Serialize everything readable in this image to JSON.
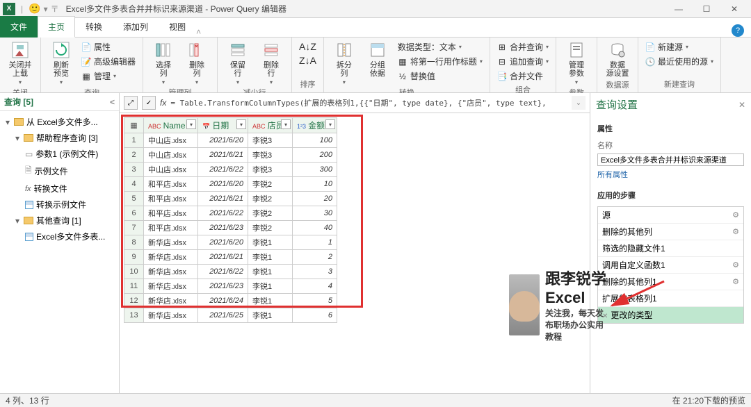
{
  "titlebar": {
    "title": "Excel多文件多表合并并标识来源渠道 - Power Query 编辑器"
  },
  "ribbon_tabs": {
    "file": "文件",
    "home": "主页",
    "transform": "转换",
    "addcol": "添加列",
    "view": "视图"
  },
  "ribbon": {
    "close_apply": "关闭并\n上载",
    "refresh": "刷新\n预览",
    "props": "属性",
    "adv_editor": "高级编辑器",
    "manage": "管理",
    "choose_col": "选择\n列",
    "remove_col": "删除\n列",
    "keep_row": "保留\n行",
    "remove_row": "删除\n行",
    "sort_asc": "↑",
    "sort_desc": "↓",
    "split": "拆分\n列",
    "groupby": "分组\n依据",
    "dtype": "数据类型：文本",
    "first_row": "将第一行用作标题",
    "replace": "替换值",
    "merge": "合并查询",
    "append": "追加查询",
    "combine_files": "合并文件",
    "params": "管理\n参数",
    "datasrc": "数据\n源设置",
    "newsrc": "新建源",
    "recent": "最近使用的源",
    "grp_close": "关闭",
    "grp_query": "查询",
    "grp_cols": "管理列",
    "grp_rows": "减少行",
    "grp_sort": "排序",
    "grp_trans": "转换",
    "grp_combine": "组合",
    "grp_params": "参数",
    "grp_ds": "数据源",
    "grp_new": "新建查询"
  },
  "queries": {
    "header": "查询 [5]",
    "root": "从 Excel多文件多...",
    "helper_folder": "帮助程序查询 [3]",
    "param1": "参数1 (示例文件)",
    "sample": "示例文件",
    "transform_file": "转换文件",
    "transform_sample": "转换示例文件",
    "other_folder": "其他查询 [1]",
    "main_query": "Excel多文件多表..."
  },
  "formula": "= Table.TransformColumnTypes(扩展的表格列1,{{\"日期\", type date}, {\"店员\", type text},",
  "columns": {
    "name": "Name",
    "date": "日期",
    "emp": "店员",
    "amt": "金额",
    "abc": "ABC",
    "cal": "📅",
    "num": "1²3"
  },
  "rows": [
    {
      "n": "中山店.xlsx",
      "d": "2021/6/20",
      "e": "李锐3",
      "a": "100"
    },
    {
      "n": "中山店.xlsx",
      "d": "2021/6/21",
      "e": "李锐3",
      "a": "200"
    },
    {
      "n": "中山店.xlsx",
      "d": "2021/6/22",
      "e": "李锐3",
      "a": "300"
    },
    {
      "n": "和平店.xlsx",
      "d": "2021/6/20",
      "e": "李锐2",
      "a": "10"
    },
    {
      "n": "和平店.xlsx",
      "d": "2021/6/21",
      "e": "李锐2",
      "a": "20"
    },
    {
      "n": "和平店.xlsx",
      "d": "2021/6/22",
      "e": "李锐2",
      "a": "30"
    },
    {
      "n": "和平店.xlsx",
      "d": "2021/6/23",
      "e": "李锐2",
      "a": "40"
    },
    {
      "n": "新华店.xlsx",
      "d": "2021/6/20",
      "e": "李锐1",
      "a": "1"
    },
    {
      "n": "新华店.xlsx",
      "d": "2021/6/21",
      "e": "李锐1",
      "a": "2"
    },
    {
      "n": "新华店.xlsx",
      "d": "2021/6/22",
      "e": "李锐1",
      "a": "3"
    },
    {
      "n": "新华店.xlsx",
      "d": "2021/6/23",
      "e": "李锐1",
      "a": "4"
    },
    {
      "n": "新华店.xlsx",
      "d": "2021/6/24",
      "e": "李锐1",
      "a": "5"
    },
    {
      "n": "新华店.xlsx",
      "d": "2021/6/25",
      "e": "李锐1",
      "a": "6"
    }
  ],
  "promo": {
    "big": "跟李锐学Excel",
    "small": "关注我，每天发布职场办公实用教程"
  },
  "settings": {
    "title": "查询设置",
    "props": "属性",
    "name_label": "名称",
    "name_value": "Excel多文件多表合并并标识来源渠道",
    "all_props": "所有属性",
    "steps_title": "应用的步骤",
    "steps": [
      {
        "label": "源",
        "gear": true
      },
      {
        "label": "删除的其他列",
        "gear": true
      },
      {
        "label": "筛选的隐藏文件1",
        "gear": false
      },
      {
        "label": "调用自定义函数1",
        "gear": true
      },
      {
        "label": "删除的其他列1",
        "gear": true
      },
      {
        "label": "扩展的表格列1",
        "gear": false
      },
      {
        "label": "更改的类型",
        "gear": false,
        "active": true,
        "x": true
      }
    ]
  },
  "status": {
    "left": "4 列、13 行",
    "right": "在 21:20下载的预览"
  }
}
